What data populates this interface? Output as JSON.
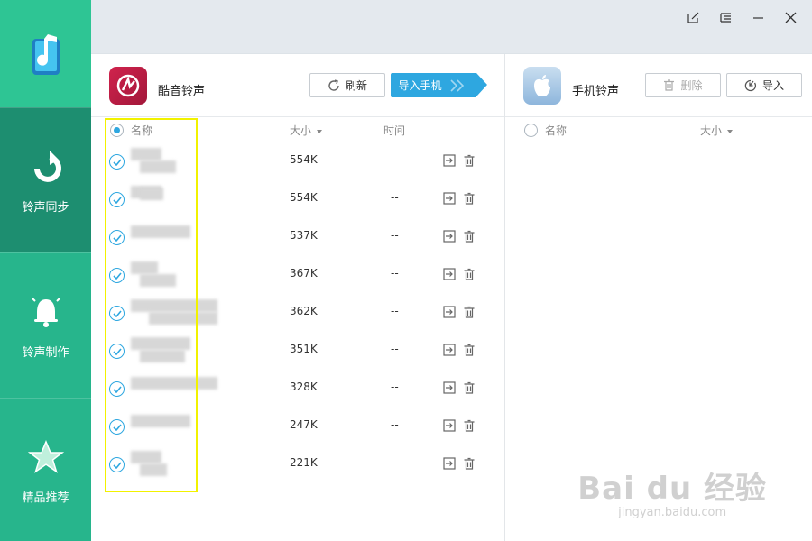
{
  "nav": {
    "items": [
      {
        "label": "铃声同步",
        "icon": "ringtone-sync-icon"
      },
      {
        "label": "铃声制作",
        "icon": "bell-icon"
      },
      {
        "label": "精品推荐",
        "icon": "star-icon"
      }
    ]
  },
  "window": {
    "controls": [
      "feedback-icon",
      "menu-icon",
      "minimize-icon",
      "close-icon"
    ]
  },
  "left_panel": {
    "title": "酷音铃声",
    "refresh_label": "刷新",
    "import_to_phone_label": "导入手机",
    "columns": {
      "name": "名称",
      "size": "大小",
      "time": "时间"
    },
    "rows": [
      {
        "size": "554K",
        "time": "--"
      },
      {
        "size": "554K",
        "time": "--"
      },
      {
        "size": "537K",
        "time": "--"
      },
      {
        "size": "367K",
        "time": "--"
      },
      {
        "size": "362K",
        "time": "--"
      },
      {
        "size": "351K",
        "time": "--"
      },
      {
        "size": "328K",
        "time": "--"
      },
      {
        "size": "247K",
        "time": "--"
      },
      {
        "size": "221K",
        "time": "--"
      }
    ]
  },
  "right_panel": {
    "title": "手机铃声",
    "delete_label": "删除",
    "import_label": "导入",
    "columns": {
      "name": "名称",
      "size": "大小"
    }
  },
  "colors": {
    "sidebar": "#27b58c",
    "sidebar_active": "#1d8e70",
    "accent": "#2ea7e0",
    "highlight": "#f2f200"
  },
  "watermark": {
    "main": "Bai du 经验",
    "sub": "jingyan.baidu.com"
  }
}
